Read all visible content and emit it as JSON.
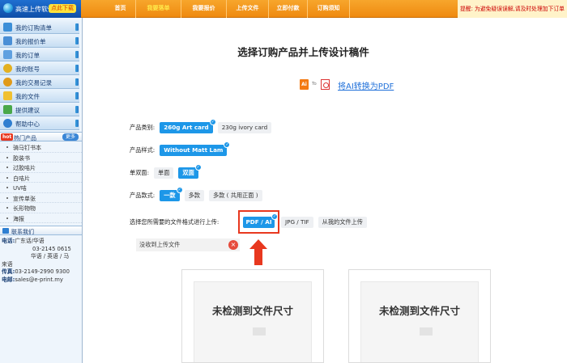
{
  "topbar": {
    "app_name": "高速上传软件",
    "download_badge": "点此下载",
    "nav": [
      {
        "label": "首页",
        "active": false
      },
      {
        "label": "我要落单",
        "active": true
      },
      {
        "label": "我要报价",
        "active": false
      },
      {
        "label": "上传文件",
        "active": false
      },
      {
        "label": "立即付款",
        "active": false
      },
      {
        "label": "订购须知",
        "active": false
      }
    ],
    "notice": "提醒: 为避免疑误误解,请及时处理加下订单"
  },
  "sidebar": {
    "menu": [
      {
        "label": "我的订购清单",
        "icon": "cart-icon",
        "color": "#3c8fd8"
      },
      {
        "label": "我的报价单",
        "icon": "list-icon",
        "color": "#4a8fd6"
      },
      {
        "label": "我的订单",
        "icon": "order-icon",
        "color": "#5fa0e0"
      },
      {
        "label": "我的账号",
        "icon": "user-icon",
        "color": "#e3b020"
      },
      {
        "label": "我的交易记录",
        "icon": "coins-icon",
        "color": "#e09a1a"
      },
      {
        "label": "我的文件",
        "icon": "folder-icon",
        "color": "#f0c030"
      },
      {
        "label": "提供建议",
        "icon": "pencil-icon",
        "color": "#49a84a"
      },
      {
        "label": "帮助中心",
        "icon": "help-icon",
        "color": "#2f7ed0"
      }
    ],
    "hot_section": {
      "tag": "hot",
      "title": "热门产品",
      "more": "更多"
    },
    "products": [
      "骑马钉书本",
      "胶装书",
      "过胶咭片",
      "白咭片",
      "UV咭",
      "宣传单张",
      "长形物物",
      "海报"
    ],
    "contact_section": {
      "title": "联系我们"
    },
    "contact": {
      "phone_label": "电话:",
      "phone_line1": "广东话/华语",
      "phone_line2": "03-2145 0615",
      "phone_line3": "华语 / 英语 / 马",
      "phone_line4": "来语",
      "fax_label": "传真:",
      "fax": "03-2149-2990 9300",
      "email_label": "电邮:",
      "email": "sales@e-print.my"
    }
  },
  "main": {
    "title": "选择订购产品并上传设计稿件",
    "convert": {
      "ai": "Ai",
      "to": "To",
      "link": "将AI转换为PDF"
    },
    "rows": [
      {
        "label": "产品类别:",
        "options": [
          {
            "label": "260g Art card",
            "selected": true
          },
          {
            "label": "230g ivory card",
            "selected": false
          }
        ]
      },
      {
        "label": "产品样式:",
        "options": [
          {
            "label": "Without Matt Lam",
            "selected": true
          }
        ]
      },
      {
        "label": "单双面:",
        "options": [
          {
            "label": "单面",
            "selected": false
          },
          {
            "label": "双面",
            "selected": true
          }
        ]
      },
      {
        "label": "产品款式:",
        "options": [
          {
            "label": "一款",
            "selected": true
          },
          {
            "label": "多款",
            "selected": false
          },
          {
            "label": "多款 ( 共用正面 )",
            "selected": false
          }
        ]
      }
    ],
    "format_row": {
      "label": "选择您所需要的文件格式进行上传:",
      "pdf": "PDF / AI",
      "jpg": "JPG / TIF",
      "from_files": "从我的文件上传"
    },
    "no_file": "没收到上传文件",
    "size_cards": [
      "未检测到文件尺寸",
      "未检测到文件尺寸"
    ]
  }
}
